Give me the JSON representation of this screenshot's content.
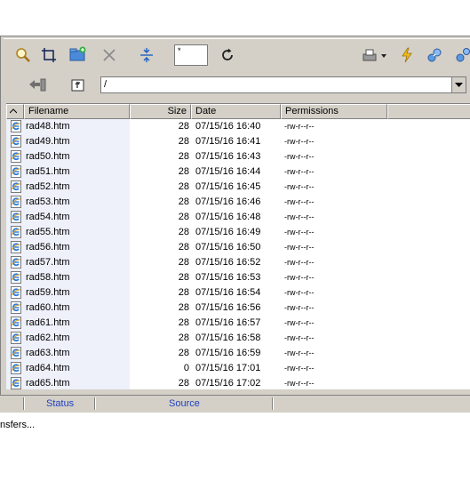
{
  "toolbar": {
    "filter_value": "*",
    "path_value": "/",
    "icons": [
      "search-icon",
      "crop-icon",
      "new-folder-icon",
      "delete-icon",
      "split-icon",
      "refresh-icon",
      "printer-icon",
      "lightning-icon",
      "connect-icon",
      "disconnect-icon",
      "back-icon",
      "parent-folder-icon"
    ]
  },
  "columns": {
    "filename": "Filename",
    "size": "Size",
    "date": "Date",
    "permissions": "Permissions"
  },
  "files": [
    {
      "name": "rad48.htm",
      "size": "28",
      "date": "07/15/16  16:40",
      "perm": "-rw-r--r--"
    },
    {
      "name": "rad49.htm",
      "size": "28",
      "date": "07/15/16  16:41",
      "perm": "-rw-r--r--"
    },
    {
      "name": "rad50.htm",
      "size": "28",
      "date": "07/15/16  16:43",
      "perm": "-rw-r--r--"
    },
    {
      "name": "rad51.htm",
      "size": "28",
      "date": "07/15/16  16:44",
      "perm": "-rw-r--r--"
    },
    {
      "name": "rad52.htm",
      "size": "28",
      "date": "07/15/16  16:45",
      "perm": "-rw-r--r--"
    },
    {
      "name": "rad53.htm",
      "size": "28",
      "date": "07/15/16  16:46",
      "perm": "-rw-r--r--"
    },
    {
      "name": "rad54.htm",
      "size": "28",
      "date": "07/15/16  16:48",
      "perm": "-rw-r--r--"
    },
    {
      "name": "rad55.htm",
      "size": "28",
      "date": "07/15/16  16:49",
      "perm": "-rw-r--r--"
    },
    {
      "name": "rad56.htm",
      "size": "28",
      "date": "07/15/16  16:50",
      "perm": "-rw-r--r--"
    },
    {
      "name": "rad57.htm",
      "size": "28",
      "date": "07/15/16  16:52",
      "perm": "-rw-r--r--"
    },
    {
      "name": "rad58.htm",
      "size": "28",
      "date": "07/15/16  16:53",
      "perm": "-rw-r--r--"
    },
    {
      "name": "rad59.htm",
      "size": "28",
      "date": "07/15/16  16:54",
      "perm": "-rw-r--r--"
    },
    {
      "name": "rad60.htm",
      "size": "28",
      "date": "07/15/16  16:56",
      "perm": "-rw-r--r--"
    },
    {
      "name": "rad61.htm",
      "size": "28",
      "date": "07/15/16  16:57",
      "perm": "-rw-r--r--"
    },
    {
      "name": "rad62.htm",
      "size": "28",
      "date": "07/15/16  16:58",
      "perm": "-rw-r--r--"
    },
    {
      "name": "rad63.htm",
      "size": "28",
      "date": "07/15/16  16:59",
      "perm": "-rw-r--r--"
    },
    {
      "name": "rad64.htm",
      "size": "0",
      "date": "07/15/16  17:01",
      "perm": "-rw-r--r--"
    },
    {
      "name": "rad65.htm",
      "size": "28",
      "date": "07/15/16  17:02",
      "perm": "-rw-r--r--"
    }
  ],
  "statusbar": {
    "status": "Status",
    "source": "Source"
  },
  "footer_text": "nsfers...",
  "colors": {
    "panel": "#d4d0c8",
    "name_column_bg": "#eef0fa",
    "status_text": "#2040c0"
  }
}
